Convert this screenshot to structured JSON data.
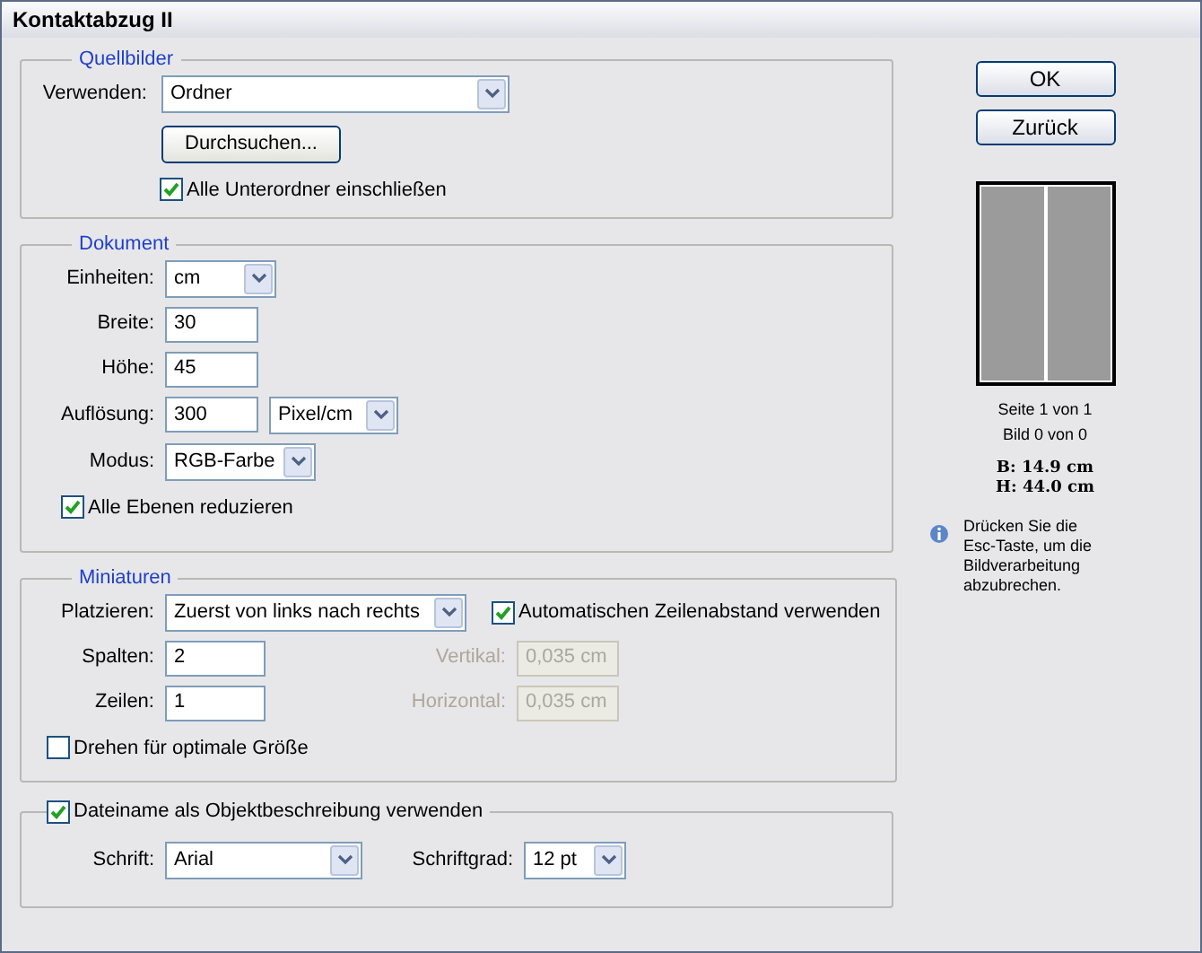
{
  "window": {
    "title": "Kontaktabzug II"
  },
  "source_images": {
    "title": "Quellbilder",
    "use": {
      "label": "Verwenden:",
      "value": "Ordner"
    },
    "browse_button": "Durchsuchen...",
    "include_subfolders": {
      "label": "Alle Unterordner einschließen",
      "checked": true
    }
  },
  "document": {
    "title": "Dokument",
    "units": {
      "label": "Einheiten:",
      "value": "cm"
    },
    "width": {
      "label": "Breite:",
      "value": "30"
    },
    "height": {
      "label": "Höhe:",
      "value": "45"
    },
    "resolution": {
      "label": "Auflösung:",
      "value": "300",
      "unit": "Pixel/cm"
    },
    "mode": {
      "label": "Modus:",
      "value": "RGB-Farbe"
    },
    "flatten": {
      "label": "Alle Ebenen reduzieren",
      "checked": true
    }
  },
  "thumbnails": {
    "title": "Miniaturen",
    "place": {
      "label": "Platzieren:",
      "value": "Zuerst von links nach rechts"
    },
    "auto_spacing": {
      "label": "Automatischen Zeilenabstand verwenden",
      "checked": true
    },
    "columns": {
      "label": "Spalten:",
      "value": "2"
    },
    "rows": {
      "label": "Zeilen:",
      "value": "1"
    },
    "vertical": {
      "label": "Vertikal:",
      "value": "0,035 cm",
      "disabled": true
    },
    "horizontal": {
      "label": "Horizontal:",
      "value": "0,035 cm",
      "disabled": true
    },
    "rotate": {
      "label": "Drehen für optimale Größe",
      "checked": false
    }
  },
  "caption": {
    "use_filename": {
      "label": "Dateiname als Objektbeschreibung verwenden",
      "checked": true
    },
    "font": {
      "label": "Schrift:",
      "value": "Arial"
    },
    "font_size": {
      "label": "Schriftgrad:",
      "value": "12 pt"
    }
  },
  "buttons": [
    "OK",
    "Zurück"
  ],
  "page_info": [
    "Seite 1 von 1",
    "Bild 0 von 0"
  ],
  "size_info": [
    "B: 14.9 cm",
    "H: 44.0 cm"
  ],
  "hint": "Drücken Sie die Esc-Taste, um die Bildverarbeitung abzubrechen."
}
